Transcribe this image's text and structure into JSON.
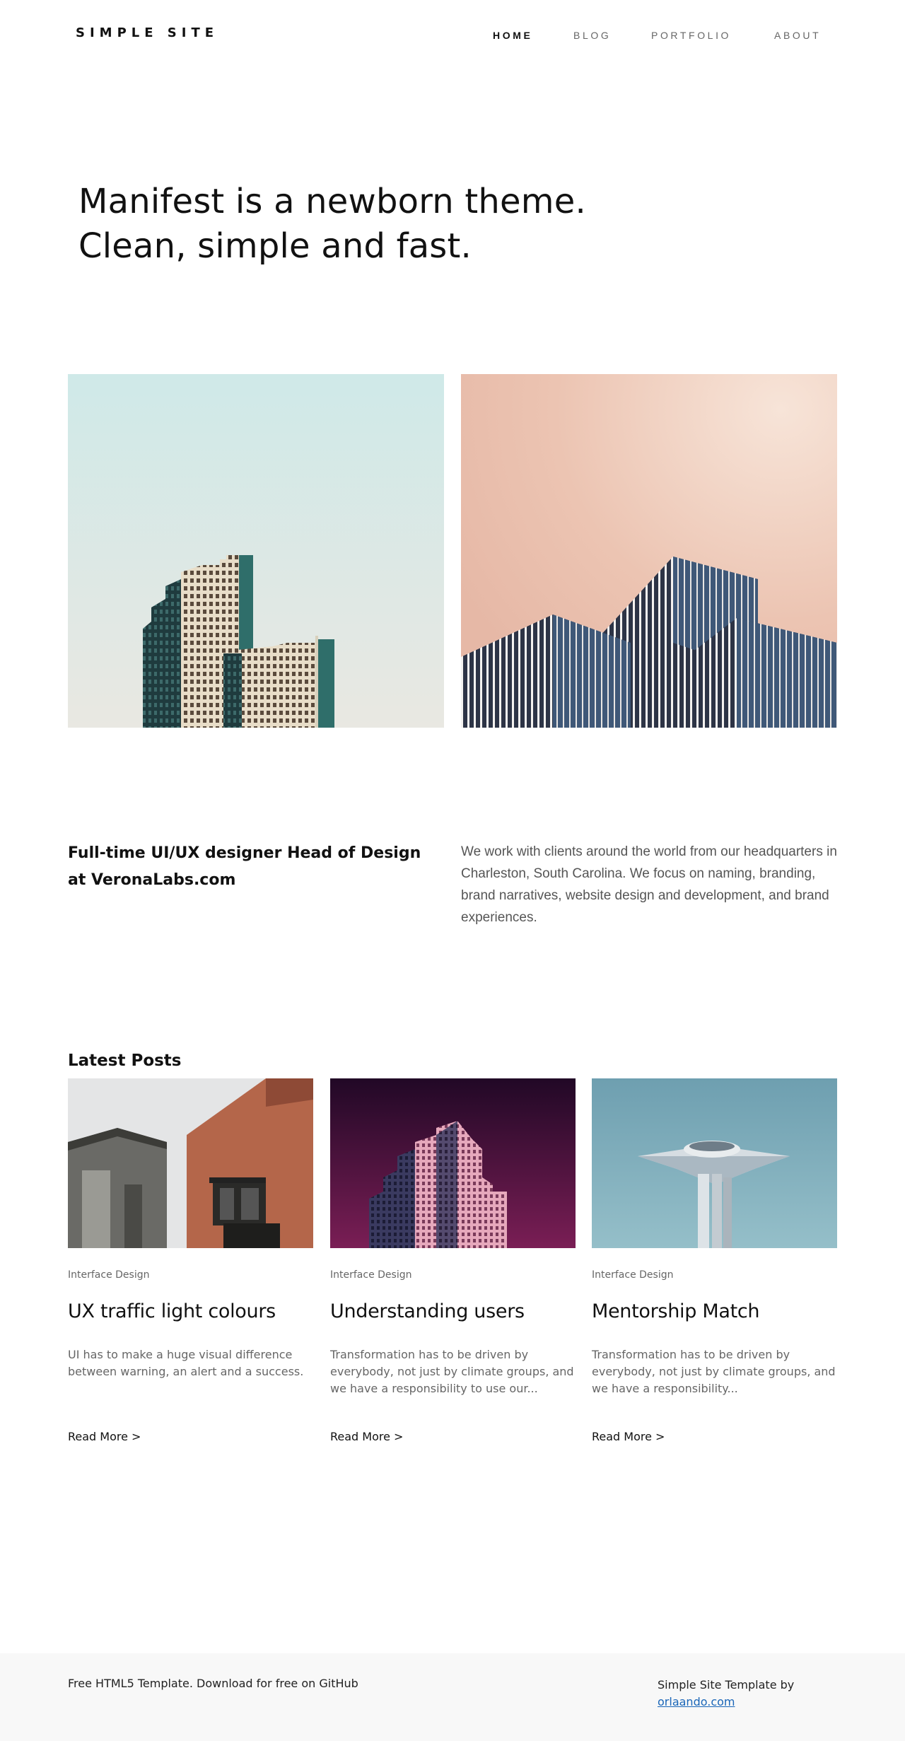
{
  "header": {
    "logo": "SIMPLE SITE",
    "nav": [
      {
        "label": "HOME",
        "active": true
      },
      {
        "label": "BLOG",
        "active": false
      },
      {
        "label": "PORTFOLIO",
        "active": false
      },
      {
        "label": "ABOUT",
        "active": false
      }
    ]
  },
  "hero": {
    "line1": "Manifest is a newborn theme.",
    "line2": "Clean, simple and fast."
  },
  "about": {
    "title": "Full-time UI/UX designer Head of Design at VeronaLabs.com",
    "text": "We work with clients around the world from our headquarters in Charleston, South Carolina. We focus on naming, branding, brand narratives, website design and development, and brand experiences."
  },
  "latest": {
    "title": "Latest Posts",
    "posts": [
      {
        "category": "Interface Design",
        "title": "UX traffic light colours",
        "excerpt": "UI has to make a huge visual difference between warning, an alert and a success.",
        "more": "Read More >"
      },
      {
        "category": "Interface Design",
        "title": "Understanding users",
        "excerpt": "Transformation has to be driven by everybody, not just by climate groups, and we have a responsibility to use our...",
        "more": "Read More >"
      },
      {
        "category": "Interface Design",
        "title": "Mentorship Match",
        "excerpt": "Transformation has to be driven by everybody, not just by climate groups, and we have a responsibility...",
        "more": "Read More >"
      }
    ]
  },
  "footer": {
    "left": "Free HTML5 Template. Download for free on GitHub",
    "right_text": "Simple Site Template by",
    "right_link": "orlaando.com"
  },
  "colors": {
    "link": "#1a66b8",
    "footer_bg": "#f8f8f8"
  }
}
